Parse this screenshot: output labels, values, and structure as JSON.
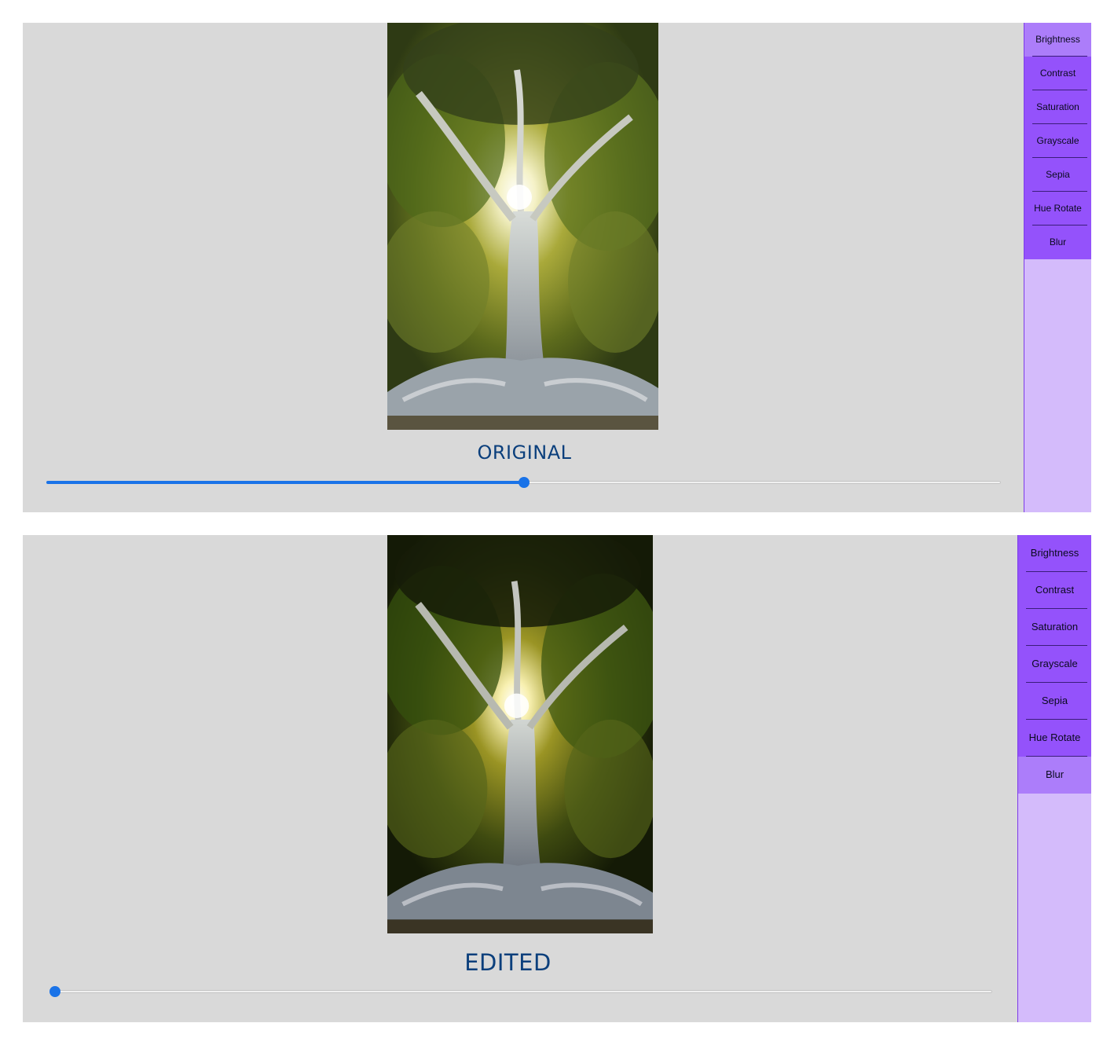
{
  "original_view": {
    "caption": "ORIGINAL",
    "slider_value_fraction": 0.5,
    "menu": [
      "Brightness",
      "Contrast",
      "Saturation",
      "Grayscale",
      "Sepia",
      "Hue Rotate",
      "Blur"
    ],
    "active_item": "Brightness"
  },
  "edited_view": {
    "caption": "EDITED",
    "slider_value_fraction": 0.0,
    "menu": [
      "Brightness",
      "Contrast",
      "Saturation",
      "Grayscale",
      "Sepia",
      "Hue Rotate",
      "Blur"
    ],
    "active_item": "Blur"
  },
  "colors": {
    "panel_bg": "#d9d9d9",
    "caption_text": "#0b3f7c",
    "slider_accent": "#1a73e8",
    "menu_button": "#9452fb",
    "menu_button_active": "#ac7dfa",
    "sidebar_bg": "#d4bbfb"
  }
}
